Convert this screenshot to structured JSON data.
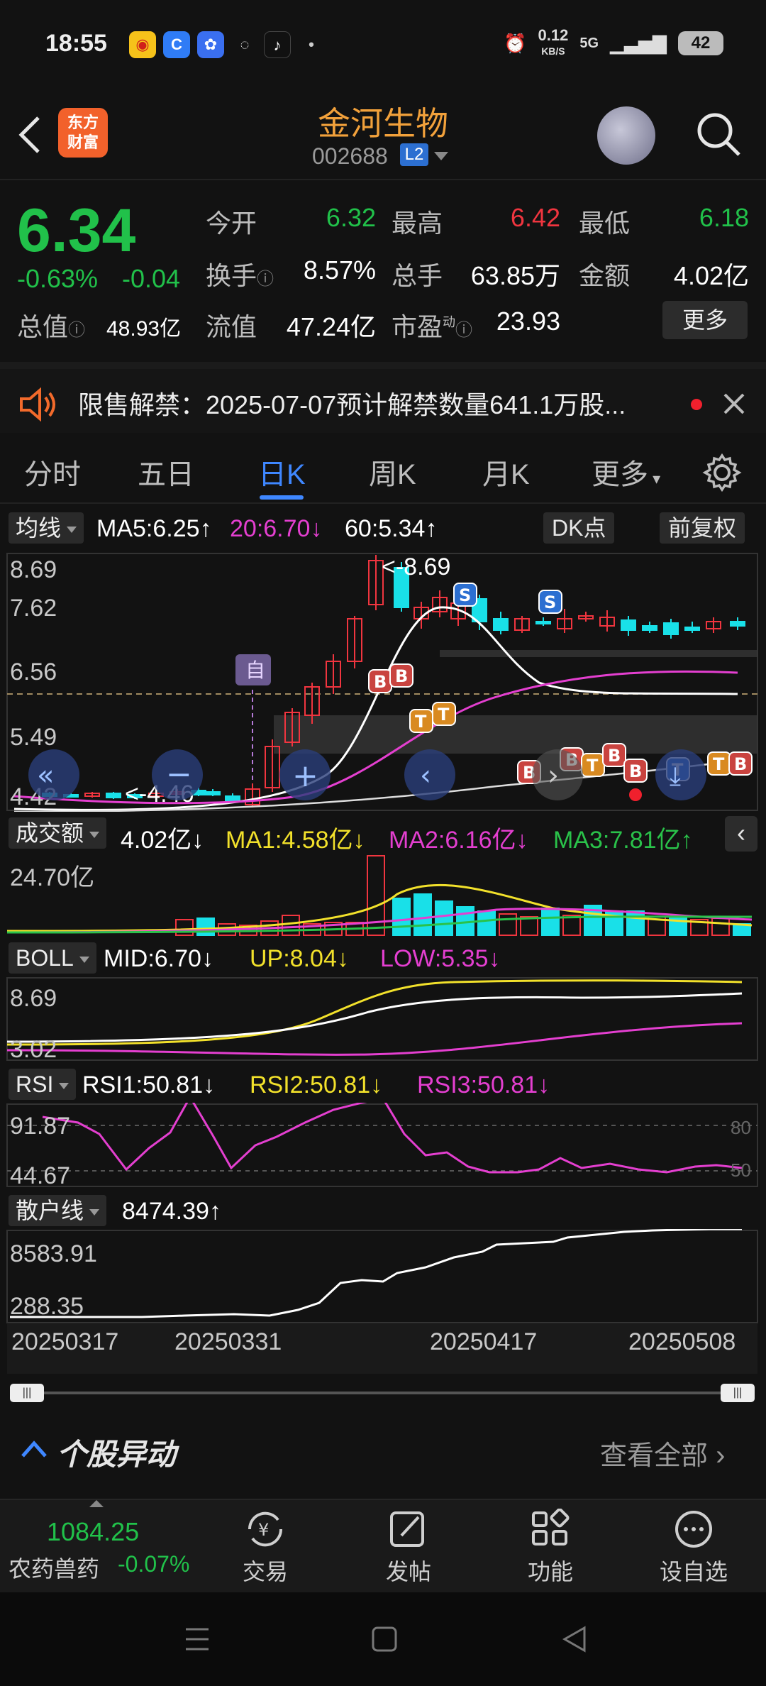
{
  "status": {
    "time": "18:55",
    "net_speed": "0.12",
    "net_unit": "KB/S",
    "network": "5G",
    "battery": "42"
  },
  "header": {
    "logo_line1": "东方",
    "logo_line2": "财富",
    "stock_name": "金河生物",
    "stock_code": "002688",
    "level": "L2"
  },
  "quote": {
    "price": "6.34",
    "change_pct": "-0.63%",
    "change_abs": "-0.04",
    "fields": [
      {
        "label": "今开",
        "value": "6.32",
        "color": "#21c14a"
      },
      {
        "label": "最高",
        "value": "6.42",
        "color": "#f0353f"
      },
      {
        "label": "最低",
        "value": "6.18",
        "color": "#21c14a"
      },
      {
        "label": "换手",
        "value": "8.57%",
        "color": "#ffffff"
      },
      {
        "label": "总手",
        "value": "63.85万",
        "color": "#ffffff"
      },
      {
        "label": "金额",
        "value": "4.02亿",
        "color": "#ffffff"
      },
      {
        "label": "总值",
        "value": "48.93亿",
        "color": "#ffffff"
      },
      {
        "label": "流值",
        "value": "47.24亿",
        "color": "#ffffff"
      },
      {
        "label": "市盈",
        "value": "23.93",
        "color": "#ffffff"
      }
    ],
    "pe_sup": "动",
    "more_label": "更多"
  },
  "notice": {
    "text": "限售解禁：2025-07-07预计解禁数量641.1万股..."
  },
  "tabs": [
    {
      "label": "分时",
      "active": false
    },
    {
      "label": "五日",
      "active": false
    },
    {
      "label": "日K",
      "active": true
    },
    {
      "label": "周K",
      "active": false
    },
    {
      "label": "月K",
      "active": false
    },
    {
      "label": "更多",
      "active": false
    }
  ],
  "ma_bar": {
    "button": "均线",
    "ma5": "MA5:6.25↑",
    "ma20": "20:6.70↓",
    "ma60": "60:5.34↑",
    "dk_button": "DK点",
    "adjust_button": "前复权"
  },
  "kline": {
    "y_labels": [
      "8.69",
      "7.62",
      "6.56",
      "5.49",
      "4.42"
    ],
    "high_annot": "<-8.69",
    "low_annot": "<-4.46",
    "zhi_label": "自"
  },
  "volume_bar": {
    "button": "成交额",
    "value": "4.02亿↓",
    "ma1": "MA1:4.58亿↓",
    "ma2": "MA2:6.16亿↓",
    "ma3": "MA3:7.81亿↑",
    "y_label": "24.70亿"
  },
  "boll_bar": {
    "button": "BOLL",
    "mid": "MID:6.70↓",
    "up": "UP:8.04↓",
    "low": "LOW:5.35↓",
    "y_labels": [
      "8.69",
      "3.02"
    ]
  },
  "rsi_bar": {
    "button": "RSI",
    "rsi1": "RSI1:50.81↓",
    "rsi2": "RSI2:50.81↓",
    "rsi3": "RSI3:50.81↓",
    "y_labels": [
      "91.87",
      "44.67"
    ],
    "ref_labels": [
      "80",
      "50"
    ]
  },
  "retail_bar": {
    "button": "散户线",
    "value": "8474.39↑",
    "y_labels": [
      "8583.91",
      "288.35"
    ]
  },
  "dates": [
    "20250317",
    "20250331",
    "20250417",
    "20250508"
  ],
  "yidong": {
    "title": "个股异动",
    "view_all": "查看全部"
  },
  "bottom_nav": {
    "index_value": "1084.25",
    "index_name": "农药兽药",
    "index_change": "-0.07%",
    "items": [
      "交易",
      "发帖",
      "功能",
      "设自选"
    ]
  },
  "colors": {
    "up": "#f0353f",
    "down": "#21c14a",
    "accent": "#3f87ff",
    "brand": "#f2612b",
    "ma5": "#ffffff",
    "ma20": "#e43fd0",
    "ma60": "#ffffff",
    "boll_up": "#f2e12b",
    "bar_down": "#19e0e8"
  }
}
